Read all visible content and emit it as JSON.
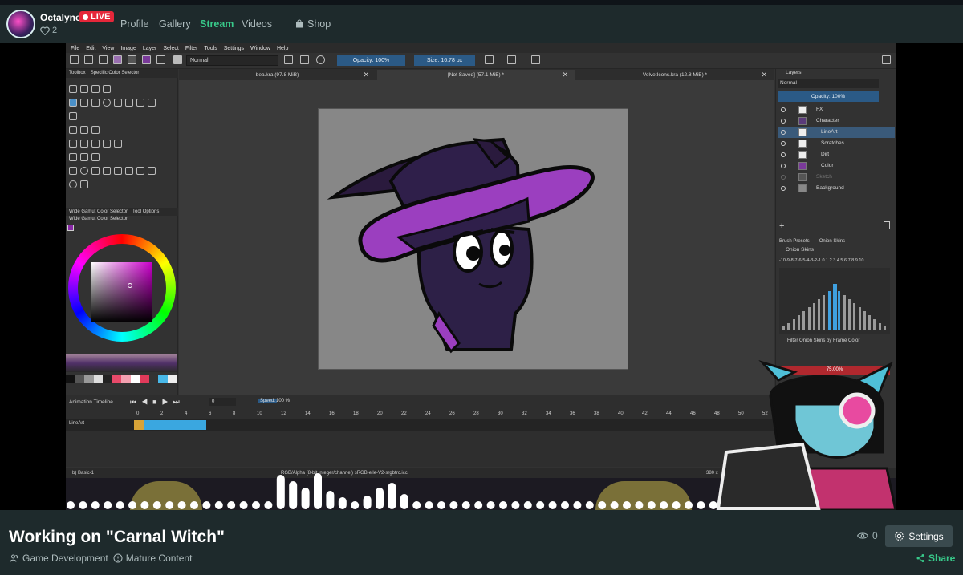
{
  "channel": {
    "name": "Octalyne",
    "live_label": "LIVE",
    "likes": "2"
  },
  "nav": {
    "items": [
      {
        "label": "Profile",
        "active": false
      },
      {
        "label": "Gallery",
        "active": false
      },
      {
        "label": "Stream",
        "active": true
      },
      {
        "label": "Videos",
        "active": false
      },
      {
        "label": "Shop",
        "active": false
      }
    ]
  },
  "krita": {
    "menu": [
      "File",
      "Edit",
      "View",
      "Image",
      "Layer",
      "Select",
      "Filter",
      "Tools",
      "Settings",
      "Window",
      "Help"
    ],
    "blend_mode": "Normal",
    "opacity": "Opacity: 100%",
    "size": "Size: 16.78 px",
    "left_tabs": [
      "Toolbox",
      "Specific Color Selector"
    ],
    "color_tabs": [
      "Wide Gamut Color Selector",
      "Tool Options"
    ],
    "color_panel_title": "Wide Gamut Color Selector",
    "doc_tabs": [
      {
        "label": "bea.kra (97.8 MiB)",
        "active": false
      },
      {
        "label": "[Not Saved]  (57.1 MiB) *",
        "active": true
      },
      {
        "label": "VelvetIcons.kra (12.8 MiB) *",
        "active": false
      }
    ],
    "layers_title": "Layers",
    "layer_blend": "Normal",
    "layer_opacity": "Opacity: 100%",
    "layers": [
      {
        "name": "FX",
        "selected": false,
        "dim": false
      },
      {
        "name": "Character",
        "selected": false,
        "dim": false
      },
      {
        "name": "LineArt",
        "selected": true,
        "dim": false
      },
      {
        "name": "Scratches",
        "selected": false,
        "dim": false
      },
      {
        "name": "Dirt",
        "selected": false,
        "dim": false
      },
      {
        "name": "Color",
        "selected": false,
        "dim": false
      },
      {
        "name": "Sketch",
        "selected": false,
        "dim": true
      },
      {
        "name": "Background",
        "selected": false,
        "dim": false
      }
    ],
    "brush_tabs": [
      "Brush Presets",
      "Onion Skins"
    ],
    "onion_title": "Onion Skins",
    "onion_numbers": "-10-9-8-7-6-5-4-3-2-1  0  1 2 3 4 5 6 7 8 9 10",
    "onion_filter": "Filter Onion Skins by Frame Color",
    "onion_percent": "75.00%",
    "timeline_title": "Animation Timeline",
    "frame_field": "0",
    "speed_label": "Speed:",
    "speed_value": "100 %",
    "frame_numbers": [
      "0",
      "2",
      "4",
      "6",
      "8",
      "10",
      "12",
      "14",
      "16",
      "18",
      "20",
      "22",
      "24",
      "26",
      "28",
      "30",
      "32",
      "34",
      "36",
      "38",
      "40",
      "42",
      "44",
      "46",
      "48",
      "50",
      "52"
    ],
    "timeline_layer": "LineArt",
    "status_left": "b) Basic-1",
    "status_center": "RGB/Alpha (8-bit integer/channel)  sRGB-elle-V2-srgbtrc.icc",
    "status_right": "380 x"
  },
  "footer": {
    "title": "Working on \"Carnal Witch\"",
    "category": "Game Development",
    "rating": "Mature Content",
    "viewers": "0",
    "settings_label": "Settings",
    "share_label": "Share"
  },
  "colors": {
    "accent_green": "#38c98a",
    "live_red": "#e5273a",
    "panel_bg": "#1e2a2c",
    "hat_purple": "#9b3fbf"
  }
}
